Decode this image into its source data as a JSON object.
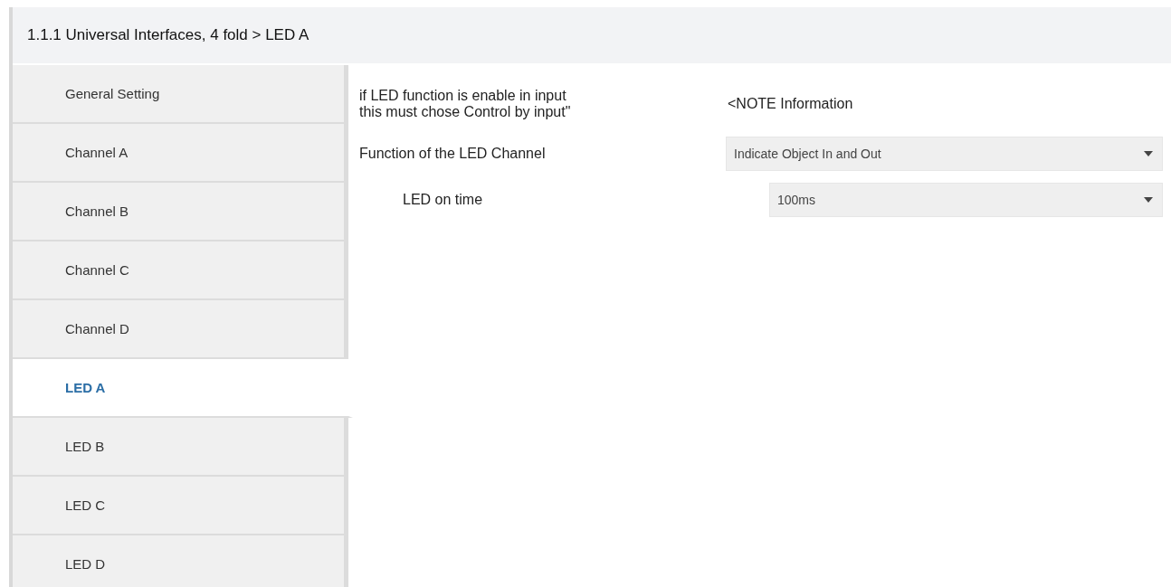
{
  "header": {
    "title": "1.1.1 Universal Interfaces, 4 fold > LED A"
  },
  "sidebar": {
    "items": [
      {
        "label": "General Setting",
        "selected": false
      },
      {
        "label": "Channel A",
        "selected": false
      },
      {
        "label": "Channel B",
        "selected": false
      },
      {
        "label": "Channel C",
        "selected": false
      },
      {
        "label": "Channel D",
        "selected": false
      },
      {
        "label": "LED A",
        "selected": true
      },
      {
        "label": "LED B",
        "selected": false
      },
      {
        "label": "LED C",
        "selected": false
      },
      {
        "label": "LED D",
        "selected": false
      }
    ]
  },
  "parameters": [
    {
      "kind": "note",
      "label": "if LED function is enable in input\nthis must chose Control by input\"",
      "value": "<NOTE Information"
    },
    {
      "kind": "dropdown",
      "label": "Function of the LED Channel",
      "value": "Indicate Object In and Out",
      "children": [
        {
          "kind": "dropdown",
          "label": "LED on time",
          "value": "100ms"
        }
      ]
    }
  ]
}
